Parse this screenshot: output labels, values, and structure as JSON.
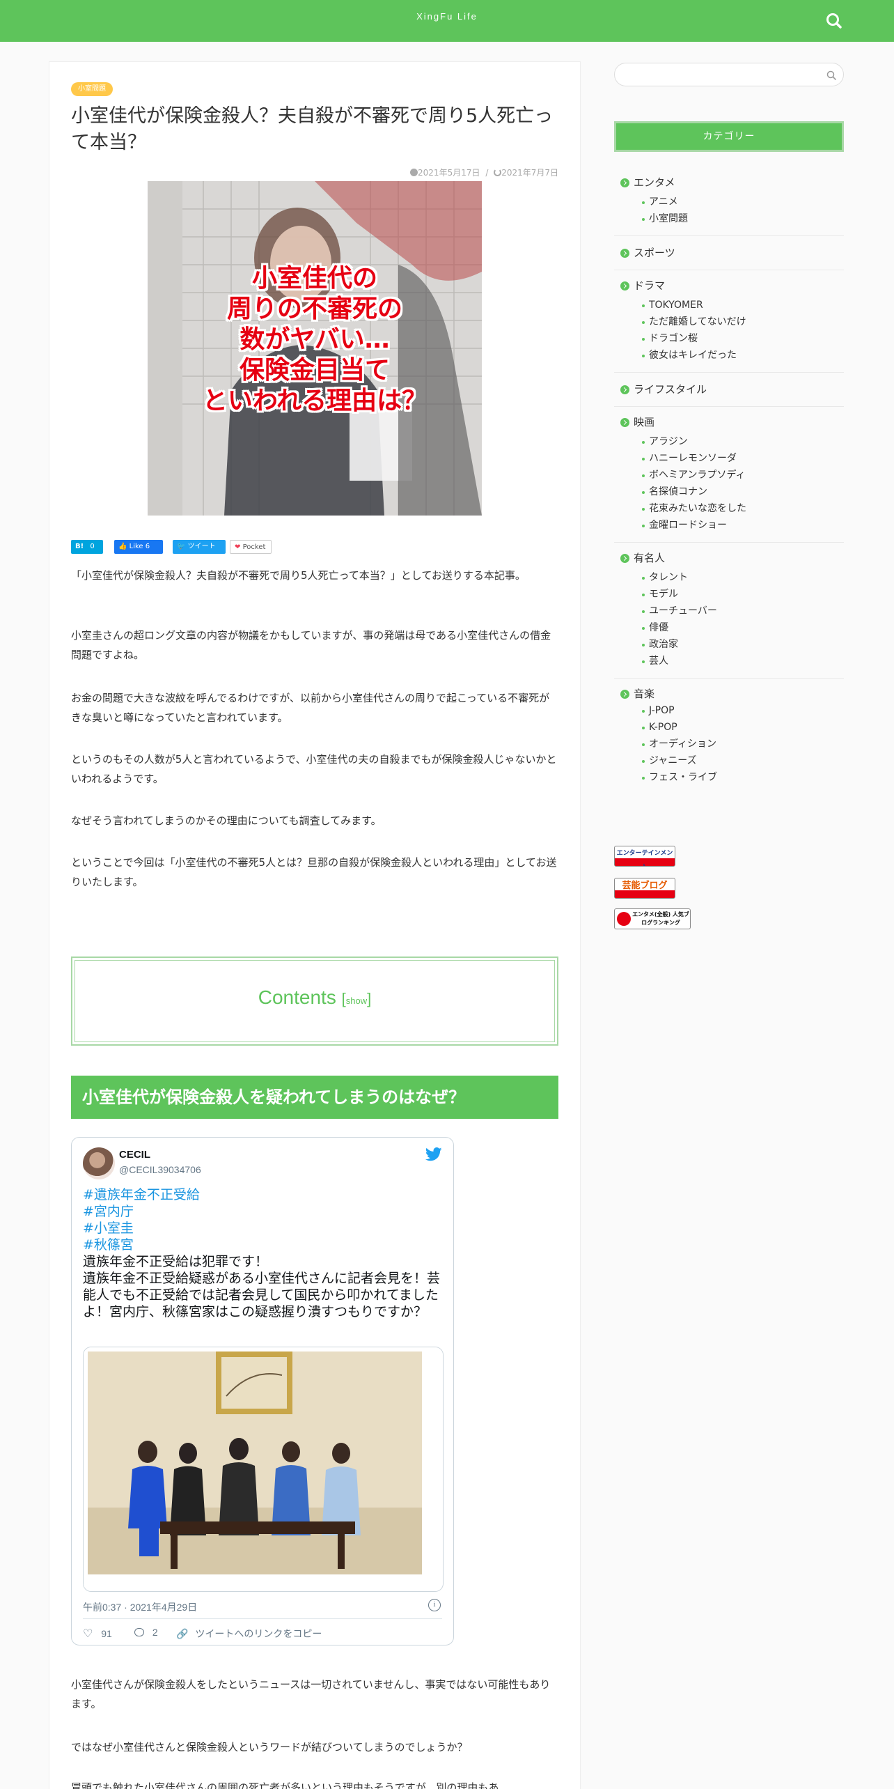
{
  "header": {
    "site_title": "XingFu Life",
    "search_icon": "search-icon"
  },
  "article": {
    "category_badge": "小室問題",
    "title": "小室佳代が保険金殺人？夫自殺が不審死で周り5人死亡って本当？",
    "published": "2021年5月17日",
    "updated": "2021年7月7日",
    "date_separator": "/",
    "hero_text": [
      "小室佳代の",
      "周りの不審死の",
      "数がヤバい…",
      "保険金目当て",
      "といわれる理由は？"
    ],
    "share": {
      "hatena_label": "B!",
      "hatena_count": "0",
      "fb_label": "Like 6",
      "tweet_label": "ツイート",
      "pocket_label": "Pocket"
    },
    "paragraphs": [
      "「小室佳代が保険金殺人？夫自殺が不審死で周り5人死亡って本当？」としてお送りする本記事。",
      "小室圭さんの超ロング文章の内容が物議をかもしていますが、事の発端は母である小室佳代さんの借金問題ですよね。",
      "お金の問題で大きな波紋を呼んでるわけですが、以前から小室佳代さんの周りで起こっている不審死がきな臭いと噂になっていたと言われています。",
      "というのもその人数が5人と言われているようで、小室佳代の夫の自殺までもが保険金殺人じゃないかといわれるようです。",
      "なぜそう言われてしまうのかその理由についても調査してみます。",
      "ということで今回は「小室佳代の不審死5人とは？旦那の自殺が保険金殺人といわれる理由」としてお送りいたします。"
    ],
    "toc": {
      "title": "Contents",
      "bracket_open": "[",
      "show_label": "show",
      "bracket_close": "]"
    },
    "h2": "小室佳代が保険金殺人を疑われてしまうのはなぜ？",
    "tweet": {
      "name": "CECIL",
      "handle": "@CECIL39034706",
      "hashtags": [
        "#遺族年金不正受給",
        "#宮内庁",
        "#小室圭",
        "#秋篠宮"
      ],
      "lines": [
        "遺族年金不正受給は犯罪です！",
        "遺族年金不正受給疑惑がある小室佳代さんに記者会見を！芸能人でも不正受給では記者会見して国民から叩かれてましたよ！宮内庁、秋篠宮家はこの疑惑握り潰すつもりですか？"
      ],
      "timestamp": "午前0:37 · 2021年4月29日",
      "likes": "91",
      "replies": "2",
      "copy_link": "ツイートへのリンクをコピー"
    },
    "after_paragraphs": [
      "小室佳代さんが保険金殺人をしたというニュースは一切されていませんし、事実ではない可能性もあります。",
      "ではなぜ小室佳代さんと保険金殺人というワードが結びついてしまうのでしょうか？",
      "冒頭でも触れた小室佳代さんの周囲の死亡者が多いという理由もそうですが、別の理由もあ"
    ]
  },
  "sidebar": {
    "search_placeholder": "",
    "category_header": "カテゴリー",
    "categories": [
      {
        "label": "エンタメ",
        "children": [
          "アニメ",
          "小室問題"
        ]
      },
      {
        "label": "スポーツ",
        "children": []
      },
      {
        "label": "ドラマ",
        "children": [
          "TOKYOMER",
          "ただ離婚してないだけ",
          "ドラゴン桜",
          "彼女はキレイだった"
        ]
      },
      {
        "label": "ライフスタイル",
        "children": []
      },
      {
        "label": "映画",
        "children": [
          "アラジン",
          "ハニーレモンソーダ",
          "ボヘミアンラプソディ",
          "名探偵コナン",
          "花束みたいな恋をした",
          "金曜ロードショー"
        ]
      },
      {
        "label": "有名人",
        "children": [
          "タレント",
          "モデル",
          "ユーチューバー",
          "俳優",
          "政治家",
          "芸人"
        ]
      },
      {
        "label": "音楽",
        "children": [
          "J-POP",
          "K-POP",
          "オーディション",
          "ジャニーズ",
          "フェス・ライブ"
        ]
      }
    ],
    "ranking_badges": [
      "エンターテインメント",
      "芸能ブログ",
      "エンタメ(全般) 人気ブログランキング"
    ]
  },
  "colors": {
    "accent": "#5ec45b",
    "badge": "#ffc84a",
    "hero_text": "#e60012",
    "twitter_link": "#1b95e0"
  }
}
